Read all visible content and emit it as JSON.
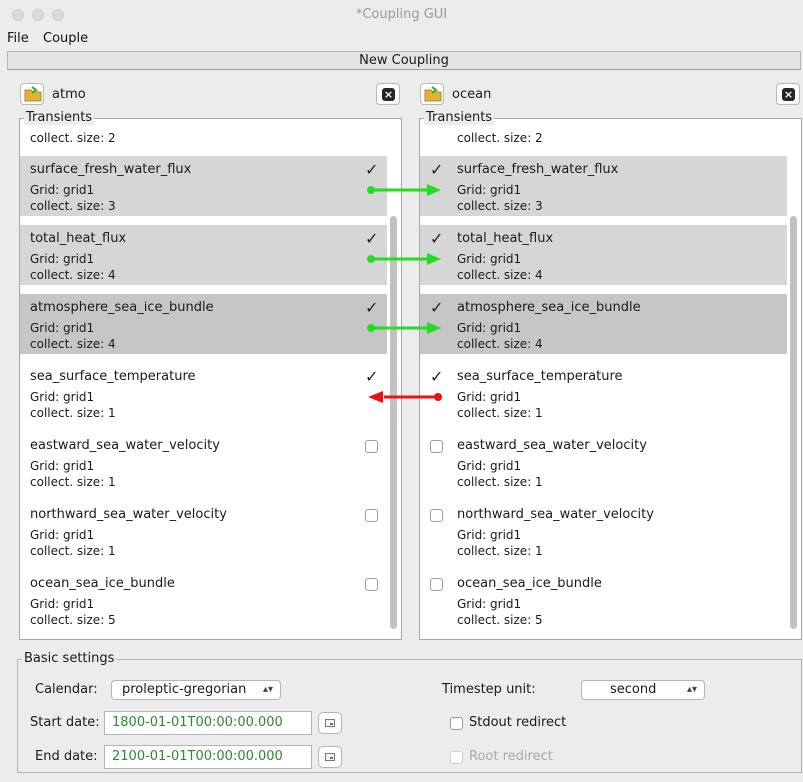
{
  "window": {
    "title": "*Coupling GUI"
  },
  "menu": {
    "file": "File",
    "couple": "Couple"
  },
  "tab": {
    "label": "New Coupling"
  },
  "left": {
    "component": "atmo",
    "group_title": "Transients",
    "top_partial": "collect. size: 2",
    "items": [
      {
        "name": "surface_fresh_water_flux",
        "grid": "Grid: grid1",
        "collect": "collect. size: 3",
        "checked": true
      },
      {
        "name": "total_heat_flux",
        "grid": "Grid: grid1",
        "collect": "collect. size: 4",
        "checked": true
      },
      {
        "name": "atmosphere_sea_ice_bundle",
        "grid": "Grid: grid1",
        "collect": "collect. size: 4",
        "checked": true
      },
      {
        "name": "sea_surface_temperature",
        "grid": "Grid: grid1",
        "collect": "collect. size: 1",
        "checked": true
      },
      {
        "name": "eastward_sea_water_velocity",
        "grid": "Grid: grid1",
        "collect": "collect. size: 1",
        "checked": false
      },
      {
        "name": "northward_sea_water_velocity",
        "grid": "Grid: grid1",
        "collect": "collect. size: 1",
        "checked": false
      },
      {
        "name": "ocean_sea_ice_bundle",
        "grid": "Grid: grid1",
        "collect": "collect. size: 5",
        "checked": false
      }
    ]
  },
  "right": {
    "component": "ocean",
    "group_title": "Transients",
    "top_partial": "collect. size: 2",
    "items": [
      {
        "name": "surface_fresh_water_flux",
        "grid": "Grid: grid1",
        "collect": "collect. size: 3",
        "checked": true
      },
      {
        "name": "total_heat_flux",
        "grid": "Grid: grid1",
        "collect": "collect. size: 4",
        "checked": true
      },
      {
        "name": "atmosphere_sea_ice_bundle",
        "grid": "Grid: grid1",
        "collect": "collect. size: 4",
        "checked": true
      },
      {
        "name": "sea_surface_temperature",
        "grid": "Grid: grid1",
        "collect": "collect. size: 1",
        "checked": true
      },
      {
        "name": "eastward_sea_water_velocity",
        "grid": "Grid: grid1",
        "collect": "collect. size: 1",
        "checked": false
      },
      {
        "name": "northward_sea_water_velocity",
        "grid": "Grid: grid1",
        "collect": "collect. size: 1",
        "checked": false
      },
      {
        "name": "ocean_sea_ice_bundle",
        "grid": "Grid: grid1",
        "collect": "collect. size: 5",
        "checked": false
      }
    ]
  },
  "couplings": [
    {
      "field": "surface_fresh_water_flux",
      "direction": "atmo-to-ocean",
      "color": "#22dd22"
    },
    {
      "field": "total_heat_flux",
      "direction": "atmo-to-ocean",
      "color": "#22dd22"
    },
    {
      "field": "atmosphere_sea_ice_bundle",
      "direction": "atmo-to-ocean",
      "color": "#22dd22"
    },
    {
      "field": "sea_surface_temperature",
      "direction": "ocean-to-atmo",
      "color": "#ee1111"
    }
  ],
  "settings": {
    "group_title": "Basic settings",
    "calendar_label": "Calendar:",
    "calendar_value": "proleptic-gregorian",
    "start_label": "Start date:",
    "start_value": "1800-01-01T00:00:00.000",
    "end_label": "End date:",
    "end_value": "2100-01-01T00:00:00.000",
    "timestep_label": "Timestep unit:",
    "timestep_value": "second",
    "stdout_label": "Stdout redirect",
    "root_label": "Root redirect"
  }
}
